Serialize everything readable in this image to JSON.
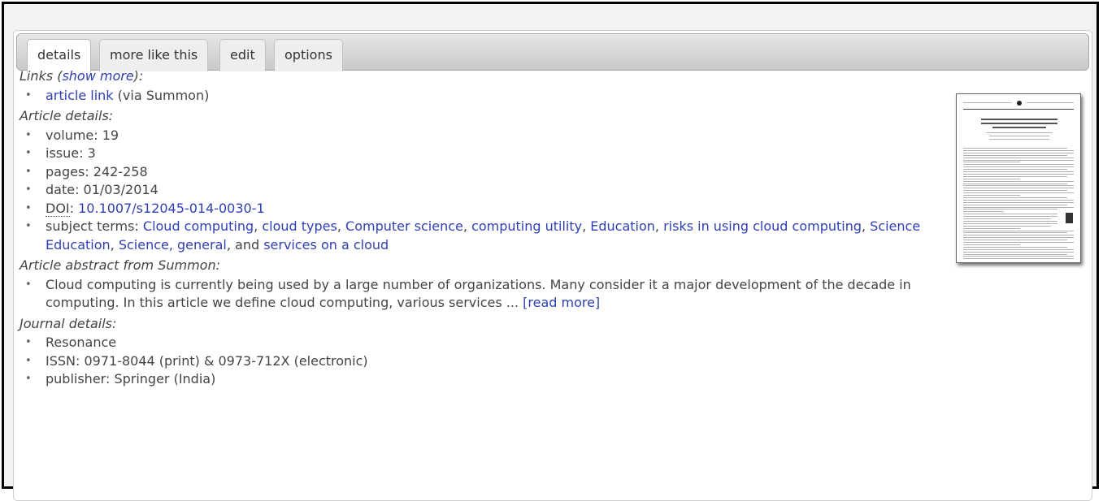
{
  "tabs": [
    {
      "label": "details",
      "active": true
    },
    {
      "label": "more like this",
      "active": false
    },
    {
      "label": "edit",
      "active": false
    },
    {
      "label": "options",
      "active": false
    }
  ],
  "links": {
    "heading_prefix": "Links (",
    "show_more": "show more",
    "heading_suffix": "):",
    "article_link": "article link",
    "article_link_via": " (via Summon)"
  },
  "article_details": {
    "heading": "Article details:",
    "volume": "volume: 19",
    "issue": "issue: 3",
    "pages": "pages: 242-258",
    "date": "date: 01/03/2014",
    "doi_label": "DOI",
    "doi_sep": ": ",
    "doi_value": "10.1007/s12045-014-0030-1",
    "subject_prefix": "subject terms: ",
    "subject_terms": [
      "Cloud computing",
      "cloud types",
      "Computer science",
      "computing utility",
      "Education",
      "risks in using cloud computing",
      "Science Education",
      "Science, general"
    ],
    "subject_last_joiner": ", and ",
    "subject_last_term": "services on a cloud"
  },
  "abstract": {
    "heading": "Article abstract from Summon:",
    "text": "Cloud computing is currently being used by a large number of organizations. Many consider it a major development of the decade in computing. In this article we define cloud computing, various services ... ",
    "read_more": "[read more]"
  },
  "journal": {
    "heading": "Journal details:",
    "name": "Resonance",
    "issn": "ISSN: 0971-8044 (print) & 0973-712X (electronic)",
    "publisher": "publisher: Springer (India)"
  },
  "colors": {
    "link": "#2e3fb3",
    "text": "#444444",
    "frame_border": "#000000"
  },
  "icons": {
    "thumbnail": "article-first-page-thumbnail"
  }
}
